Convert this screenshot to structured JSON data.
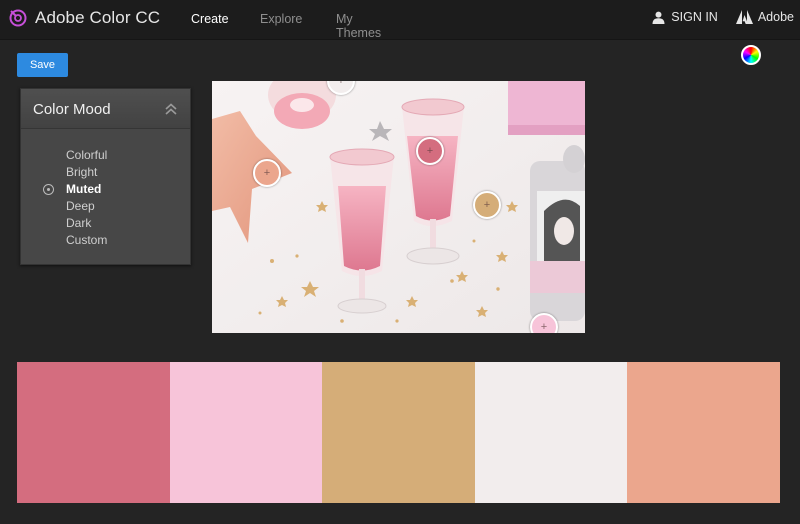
{
  "app": {
    "title": "Adobe Color CC",
    "nav": [
      "Create",
      "Explore",
      "My Themes"
    ],
    "active_nav": "Create",
    "sign_in": "SIGN IN",
    "adobe": "Adobe"
  },
  "toolbar": {
    "save_label": "Save"
  },
  "mood": {
    "title": "Color Mood",
    "options": [
      "Colorful",
      "Bright",
      "Muted",
      "Deep",
      "Dark",
      "Custom"
    ],
    "selected": "Muted"
  },
  "icons": {
    "logo": "adobe-color-logo-icon",
    "user": "user-icon",
    "adobe": "adobe-logo-icon",
    "color_wheel": "color-wheel-icon",
    "collapse": "chevron-up-double-icon"
  },
  "swatches": [
    {
      "color": "#d46d7f"
    },
    {
      "color": "#f7c4d9"
    },
    {
      "color": "#d5ad78"
    },
    {
      "color": "#f2eded"
    },
    {
      "color": "#eba68d"
    }
  ],
  "accent_color": "#2d8ae0"
}
